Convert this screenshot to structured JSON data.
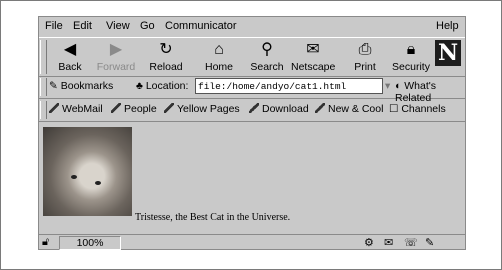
{
  "menu": {
    "file": "File",
    "edit": "Edit",
    "view": "View",
    "go": "Go",
    "communicator": "Communicator",
    "help": "Help"
  },
  "nav": {
    "back": "Back",
    "forward": "Forward",
    "reload": "Reload",
    "home": "Home",
    "search": "Search",
    "netscape": "Netscape",
    "print": "Print",
    "security": "Security",
    "logo": "N"
  },
  "location": {
    "bookmarks": "Bookmarks",
    "label": "Location:",
    "url": "file:/home/andyo/cat1.html",
    "whats_related": "What's Related"
  },
  "personal": {
    "webmail": "WebMail",
    "people": "People",
    "yellow_pages": "Yellow Pages",
    "download": "Download",
    "new_cool": "New & Cool",
    "channels": "Channels"
  },
  "content": {
    "caption": "Tristesse, the Best Cat in the Universe."
  },
  "status": {
    "zoom": "100%"
  }
}
